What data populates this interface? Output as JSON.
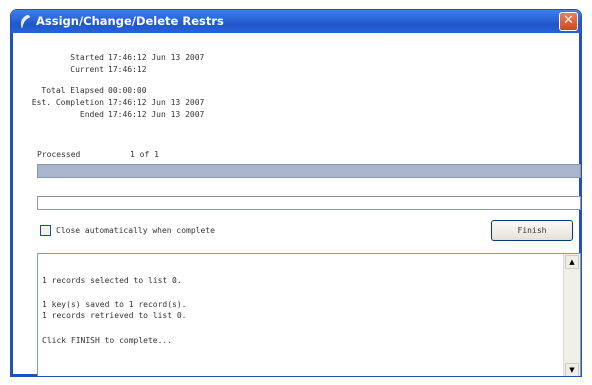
{
  "window": {
    "title": "Assign/Change/Delete Restrs",
    "close_glyph": "✕",
    "title_icon": "app-icon"
  },
  "info": {
    "started_label": "Started",
    "started_value": "17:46:12 Jun 13 2007",
    "current_label": "Current",
    "current_value": "17:46:12",
    "elapsed_label": "Total Elapsed",
    "elapsed_value": "00:00:00",
    "completion_label": "Est. Completion",
    "completion_value": "17:46:12 Jun 13 2007",
    "ended_label": "Ended",
    "ended_value": "17:46:12 Jun 13 2007"
  },
  "progress": {
    "label": "Processed",
    "count": "1 of 1",
    "fraction": 1.0,
    "secondary_fraction": 0.0
  },
  "options": {
    "close_auto_label": "Close automatically when complete",
    "close_auto_checked": false,
    "finish_label": "Finish"
  },
  "log": {
    "lines": [
      "1 records selected to list 0.",
      "",
      "1 key(s) saved to 1 record(s).",
      "1 records retrieved to list 0.",
      "",
      "Click FINISH to complete..."
    ]
  },
  "colors": {
    "title_bar": "#2a63d6",
    "progress_fill": "#a9b4cd",
    "close_button": "#d3461f"
  }
}
